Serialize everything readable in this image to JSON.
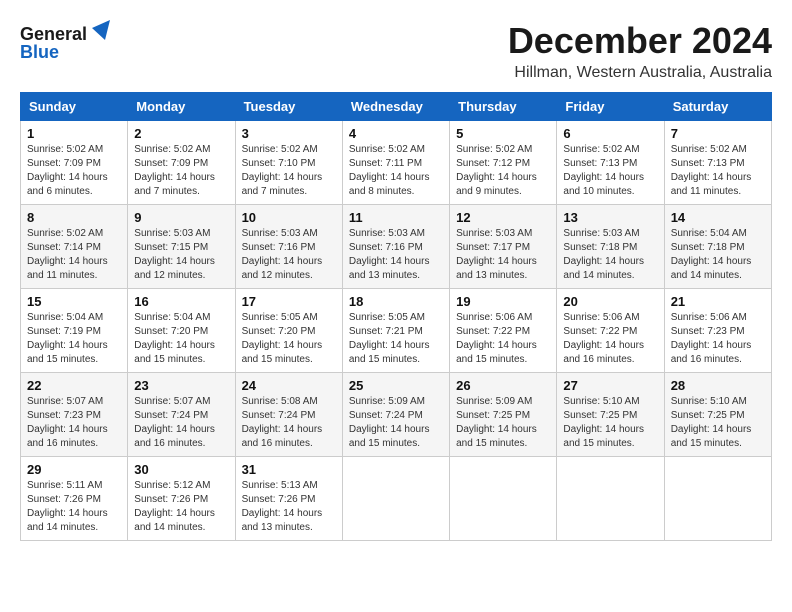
{
  "logo": {
    "line1": "General",
    "line2": "Blue"
  },
  "title": "December 2024",
  "location": "Hillman, Western Australia, Australia",
  "headers": [
    "Sunday",
    "Monday",
    "Tuesday",
    "Wednesday",
    "Thursday",
    "Friday",
    "Saturday"
  ],
  "weeks": [
    [
      {
        "day": "1",
        "info": "Sunrise: 5:02 AM\nSunset: 7:09 PM\nDaylight: 14 hours\nand 6 minutes."
      },
      {
        "day": "2",
        "info": "Sunrise: 5:02 AM\nSunset: 7:09 PM\nDaylight: 14 hours\nand 7 minutes."
      },
      {
        "day": "3",
        "info": "Sunrise: 5:02 AM\nSunset: 7:10 PM\nDaylight: 14 hours\nand 7 minutes."
      },
      {
        "day": "4",
        "info": "Sunrise: 5:02 AM\nSunset: 7:11 PM\nDaylight: 14 hours\nand 8 minutes."
      },
      {
        "day": "5",
        "info": "Sunrise: 5:02 AM\nSunset: 7:12 PM\nDaylight: 14 hours\nand 9 minutes."
      },
      {
        "day": "6",
        "info": "Sunrise: 5:02 AM\nSunset: 7:13 PM\nDaylight: 14 hours\nand 10 minutes."
      },
      {
        "day": "7",
        "info": "Sunrise: 5:02 AM\nSunset: 7:13 PM\nDaylight: 14 hours\nand 11 minutes."
      }
    ],
    [
      {
        "day": "8",
        "info": "Sunrise: 5:02 AM\nSunset: 7:14 PM\nDaylight: 14 hours\nand 11 minutes."
      },
      {
        "day": "9",
        "info": "Sunrise: 5:03 AM\nSunset: 7:15 PM\nDaylight: 14 hours\nand 12 minutes."
      },
      {
        "day": "10",
        "info": "Sunrise: 5:03 AM\nSunset: 7:16 PM\nDaylight: 14 hours\nand 12 minutes."
      },
      {
        "day": "11",
        "info": "Sunrise: 5:03 AM\nSunset: 7:16 PM\nDaylight: 14 hours\nand 13 minutes."
      },
      {
        "day": "12",
        "info": "Sunrise: 5:03 AM\nSunset: 7:17 PM\nDaylight: 14 hours\nand 13 minutes."
      },
      {
        "day": "13",
        "info": "Sunrise: 5:03 AM\nSunset: 7:18 PM\nDaylight: 14 hours\nand 14 minutes."
      },
      {
        "day": "14",
        "info": "Sunrise: 5:04 AM\nSunset: 7:18 PM\nDaylight: 14 hours\nand 14 minutes."
      }
    ],
    [
      {
        "day": "15",
        "info": "Sunrise: 5:04 AM\nSunset: 7:19 PM\nDaylight: 14 hours\nand 15 minutes."
      },
      {
        "day": "16",
        "info": "Sunrise: 5:04 AM\nSunset: 7:20 PM\nDaylight: 14 hours\nand 15 minutes."
      },
      {
        "day": "17",
        "info": "Sunrise: 5:05 AM\nSunset: 7:20 PM\nDaylight: 14 hours\nand 15 minutes."
      },
      {
        "day": "18",
        "info": "Sunrise: 5:05 AM\nSunset: 7:21 PM\nDaylight: 14 hours\nand 15 minutes."
      },
      {
        "day": "19",
        "info": "Sunrise: 5:06 AM\nSunset: 7:22 PM\nDaylight: 14 hours\nand 15 minutes."
      },
      {
        "day": "20",
        "info": "Sunrise: 5:06 AM\nSunset: 7:22 PM\nDaylight: 14 hours\nand 16 minutes."
      },
      {
        "day": "21",
        "info": "Sunrise: 5:06 AM\nSunset: 7:23 PM\nDaylight: 14 hours\nand 16 minutes."
      }
    ],
    [
      {
        "day": "22",
        "info": "Sunrise: 5:07 AM\nSunset: 7:23 PM\nDaylight: 14 hours\nand 16 minutes."
      },
      {
        "day": "23",
        "info": "Sunrise: 5:07 AM\nSunset: 7:24 PM\nDaylight: 14 hours\nand 16 minutes."
      },
      {
        "day": "24",
        "info": "Sunrise: 5:08 AM\nSunset: 7:24 PM\nDaylight: 14 hours\nand 16 minutes."
      },
      {
        "day": "25",
        "info": "Sunrise: 5:09 AM\nSunset: 7:24 PM\nDaylight: 14 hours\nand 15 minutes."
      },
      {
        "day": "26",
        "info": "Sunrise: 5:09 AM\nSunset: 7:25 PM\nDaylight: 14 hours\nand 15 minutes."
      },
      {
        "day": "27",
        "info": "Sunrise: 5:10 AM\nSunset: 7:25 PM\nDaylight: 14 hours\nand 15 minutes."
      },
      {
        "day": "28",
        "info": "Sunrise: 5:10 AM\nSunset: 7:25 PM\nDaylight: 14 hours\nand 15 minutes."
      }
    ],
    [
      {
        "day": "29",
        "info": "Sunrise: 5:11 AM\nSunset: 7:26 PM\nDaylight: 14 hours\nand 14 minutes."
      },
      {
        "day": "30",
        "info": "Sunrise: 5:12 AM\nSunset: 7:26 PM\nDaylight: 14 hours\nand 14 minutes."
      },
      {
        "day": "31",
        "info": "Sunrise: 5:13 AM\nSunset: 7:26 PM\nDaylight: 14 hours\nand 13 minutes."
      },
      null,
      null,
      null,
      null
    ]
  ]
}
